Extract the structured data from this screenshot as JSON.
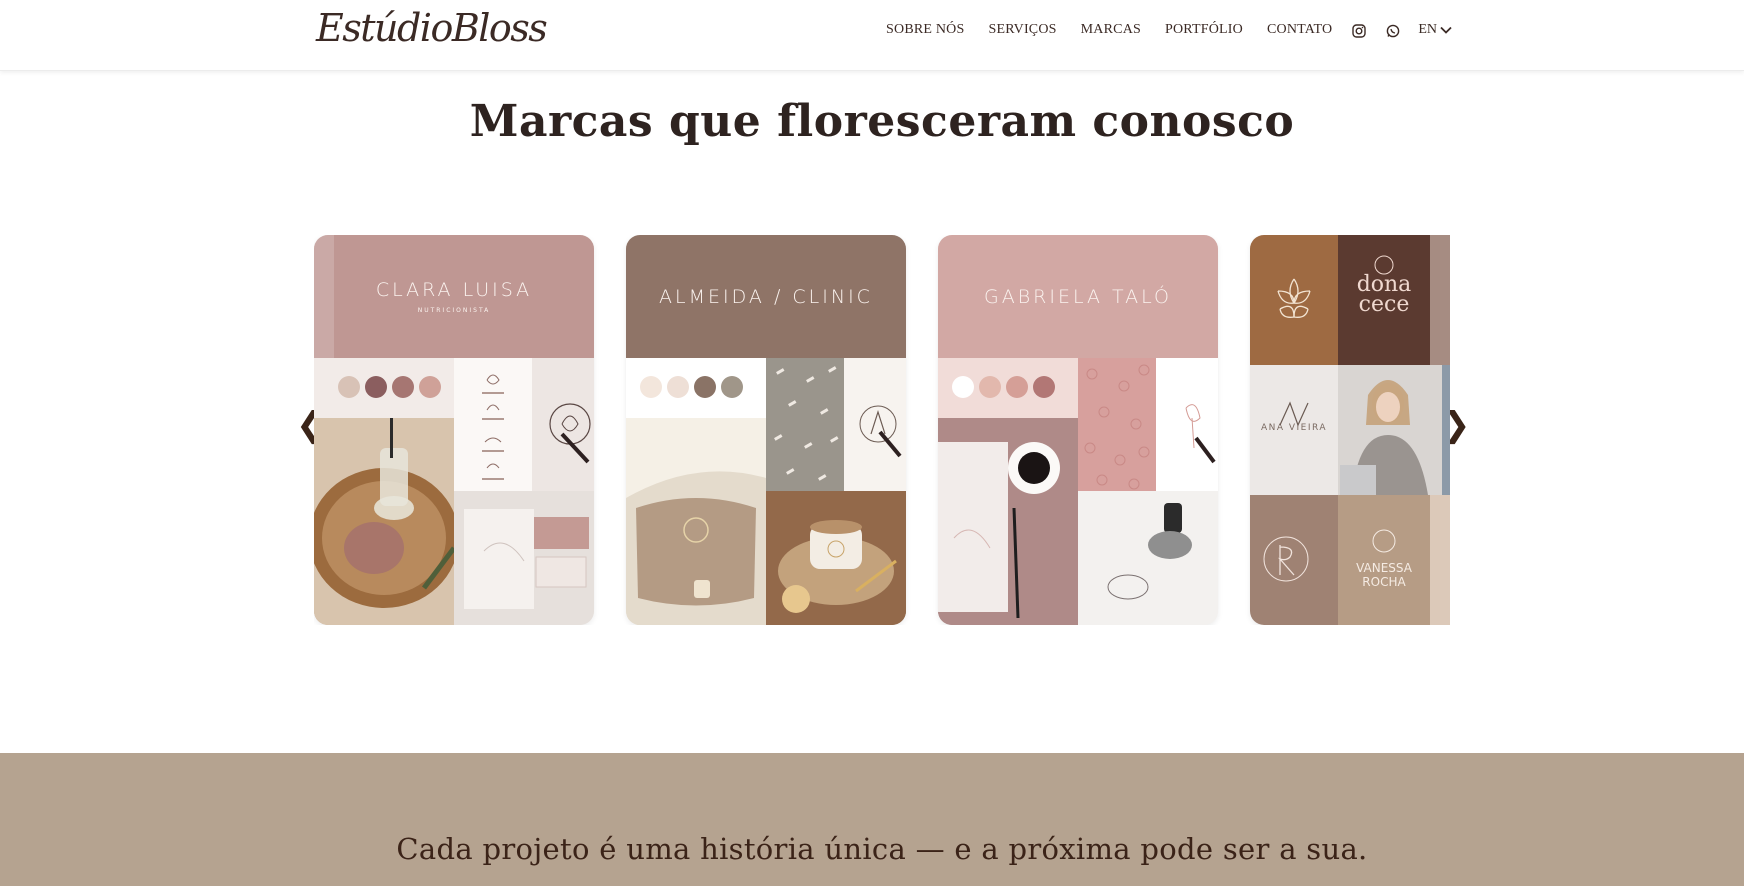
{
  "header": {
    "logo": "EstúdioBloss",
    "nav": [
      "SOBRE NÓS",
      "SERVIÇOS",
      "MARCAS",
      "PORTFÓLIO",
      "CONTATO"
    ],
    "lang": "EN"
  },
  "section": {
    "title": "Marcas que floresceram conosco"
  },
  "carousel": {
    "prev_arrow": "❮",
    "next_arrow": "❯",
    "cards": [
      {
        "brand": "CLARA LUISA",
        "brand_sub": "NUTRICIONISTA"
      },
      {
        "brand": "ALMEIDA ∕ CLINIC",
        "brand_sub": ""
      },
      {
        "brand": "GABRIELA TALÓ",
        "brand_sub": ""
      },
      {
        "brand_top": "dona cece",
        "brand_mid": "ANA VIEIRA",
        "brand_bottom": "VANESSA ROCHA"
      }
    ]
  },
  "cta": {
    "text": "Cada projeto é uma história única — e a próxima pode ser a sua."
  },
  "colors": {
    "band_bg": "#b5a390",
    "card1": "#bf9793",
    "card2": "#8f7467",
    "card3": "#d2a8a4",
    "card4_tan": "#9e6a42",
    "card4_brown": "#5b3a30"
  }
}
